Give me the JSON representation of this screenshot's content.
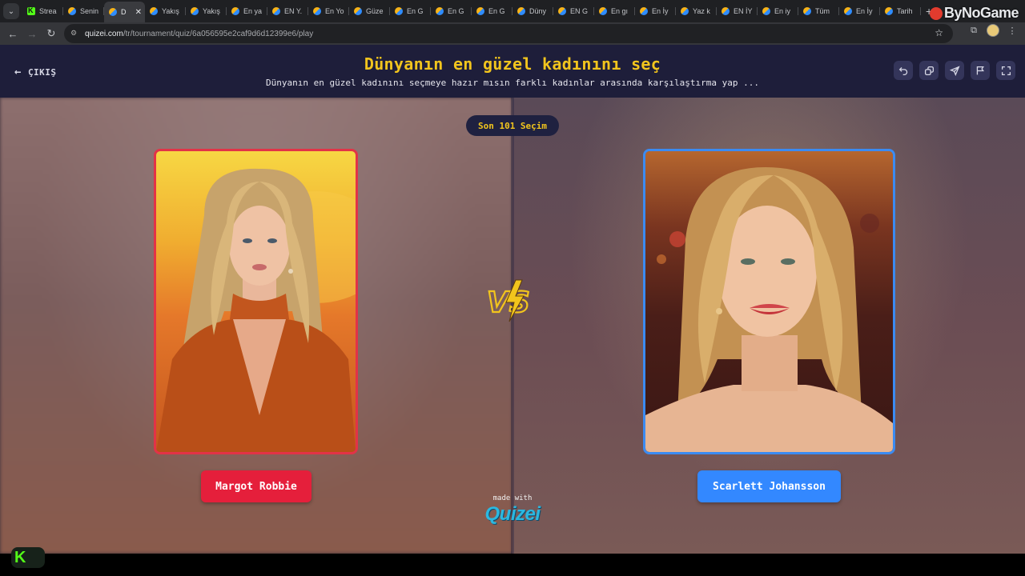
{
  "browser": {
    "tabs": [
      {
        "label": "Strea",
        "favicon": "kick"
      },
      {
        "label": "Senin",
        "favicon": "quizei"
      },
      {
        "label": "D",
        "favicon": "quizei",
        "active": true
      },
      {
        "label": "Yakış",
        "favicon": "quizei"
      },
      {
        "label": "Yakış",
        "favicon": "quizei"
      },
      {
        "label": "En ya",
        "favicon": "quizei"
      },
      {
        "label": "EN Y.",
        "favicon": "quizei"
      },
      {
        "label": "En Yo",
        "favicon": "quizei"
      },
      {
        "label": "Güze",
        "favicon": "quizei"
      },
      {
        "label": "En G",
        "favicon": "quizei"
      },
      {
        "label": "En G",
        "favicon": "quizei"
      },
      {
        "label": "En G",
        "favicon": "quizei"
      },
      {
        "label": "Düny",
        "favicon": "quizei"
      },
      {
        "label": "EN G",
        "favicon": "quizei"
      },
      {
        "label": "En gı",
        "favicon": "quizei"
      },
      {
        "label": "En İy",
        "favicon": "quizei"
      },
      {
        "label": "Yaz k",
        "favicon": "quizei"
      },
      {
        "label": "EN İY",
        "favicon": "quizei"
      },
      {
        "label": "En iy",
        "favicon": "quizei"
      },
      {
        "label": "Tüm",
        "favicon": "quizei"
      },
      {
        "label": "En İy",
        "favicon": "quizei"
      },
      {
        "label": "Tarih",
        "favicon": "quizei"
      }
    ],
    "new_tab_symbol": "+",
    "watermark": "ByNoGame",
    "url_host": "quizei.com",
    "url_path": "/tr/tournament/quiz/6a056595e2caf9d6d12399e6/play"
  },
  "header": {
    "exit_label": "ÇIKIŞ",
    "title": "Dünyanın en güzel kadınını seç",
    "subtitle": "Dünyanın en güzel kadınını seçmeye hazır mısın farklı kadınlar arasında karşılaştırma yap ..."
  },
  "round": {
    "label": "Son 101 Seçim"
  },
  "contestants": {
    "left": {
      "name": "Margot Robbie",
      "accent": "#e51f3b"
    },
    "right": {
      "name": "Scarlett Johansson",
      "accent": "#3388ff"
    }
  },
  "vs_label": "VS",
  "footer": {
    "made_with": "made with",
    "brand": "Quizei"
  },
  "taskbar": {
    "app_letter": "K"
  },
  "colors": {
    "header_bg": "#1e1e3a",
    "title": "#f2c51d",
    "left_border": "#e23347",
    "right_border": "#3b8bf2"
  }
}
